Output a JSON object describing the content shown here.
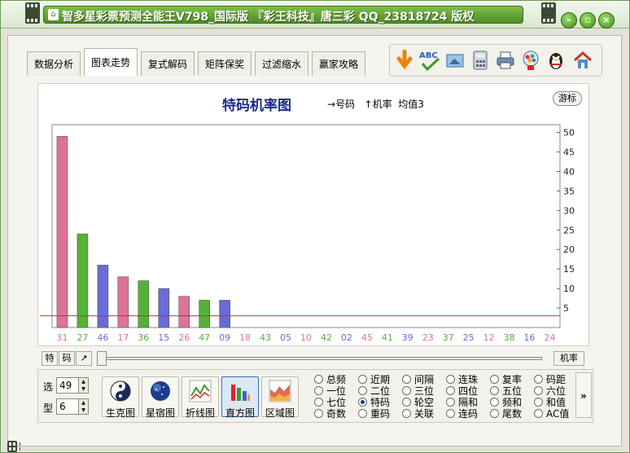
{
  "window": {
    "title": "智多星彩票预测全能王V798_国际版 『彩王科技』唐三彩 QQ_23818724 版权",
    "tabs": [
      "数据分析",
      "图表走势",
      "复式解码",
      "矩阵保奖",
      "过滤缩水",
      "赢家攻略"
    ],
    "active_tab": 1
  },
  "toolbar": {
    "icons": [
      "arrow-down-icon",
      "spellcheck-icon",
      "image-export-icon",
      "calculator-icon",
      "printer-icon",
      "gumball-icon",
      "penguin-icon",
      "home-icon"
    ]
  },
  "chart_header": {
    "title": "特码机率图",
    "legend1": "→号码",
    "legend2": "↑机率",
    "avg": "均值3",
    "float_button": "游标"
  },
  "chart_data": {
    "type": "bar",
    "title": "特码机率图",
    "xlabel": "号码",
    "ylabel": "机率",
    "ylim": [
      0,
      52
    ],
    "yticks": [
      5,
      10,
      15,
      20,
      25,
      30,
      35,
      40,
      45,
      50
    ],
    "average": 3,
    "categories": [
      "31",
      "27",
      "46",
      "17",
      "36",
      "15",
      "26",
      "47",
      "09",
      "18",
      "43",
      "05",
      "10",
      "42",
      "02",
      "45",
      "41",
      "39",
      "23",
      "37",
      "25",
      "12",
      "38",
      "16",
      "24"
    ],
    "values": [
      49,
      24,
      16,
      13,
      12,
      10,
      8,
      7,
      7,
      0,
      0,
      0,
      0,
      0,
      0,
      0,
      0,
      0,
      0,
      0,
      0,
      0,
      0,
      0,
      0
    ],
    "colors": [
      "#dd7396",
      "#55b236",
      "#6a6ad8",
      "#dd7396",
      "#55b236",
      "#6a6ad8",
      "#dd7396",
      "#55b236",
      "#6a6ad8",
      "#dd7396",
      "#55b236",
      "#6a6ad8",
      "#dd7396",
      "#55b236",
      "#6a6ad8",
      "#dd7396",
      "#55b236",
      "#6a6ad8",
      "#dd7396",
      "#55b236",
      "#6a6ad8",
      "#dd7396",
      "#55b236",
      "#6a6ad8",
      "#dd7396"
    ],
    "average_line_color": "#b33a3a"
  },
  "under_chart": {
    "btn_te": "特",
    "btn_ma": "码",
    "btn_arrow": "↗",
    "btn_jilu": "机率"
  },
  "bottom": {
    "xuan_label": "选",
    "xuan_value": "49",
    "xing_label": "型",
    "xing_value": "6",
    "chart_buttons": [
      {
        "label": "生克图",
        "icon": "yinyang-icon"
      },
      {
        "label": "星宿图",
        "icon": "globe-icon"
      },
      {
        "label": "折线图",
        "icon": "line-chart-icon"
      },
      {
        "label": "直方图",
        "icon": "bar-chart-icon"
      },
      {
        "label": "区域图",
        "icon": "area-chart-icon"
      }
    ],
    "selected_chart": 3,
    "radio_options": [
      [
        "总频",
        "一位",
        "七位",
        "奇数"
      ],
      [
        "近期",
        "二位",
        "特码",
        "重码"
      ],
      [
        "间隔",
        "三位",
        "轮空",
        "关联"
      ],
      [
        "连珠",
        "四位",
        "隔和",
        "连码"
      ],
      [
        "复率",
        "五位",
        "频和",
        "尾数"
      ],
      [
        "码距",
        "六位",
        "和值",
        "AC值"
      ]
    ],
    "selected_radio": "特码",
    "more": "»"
  }
}
